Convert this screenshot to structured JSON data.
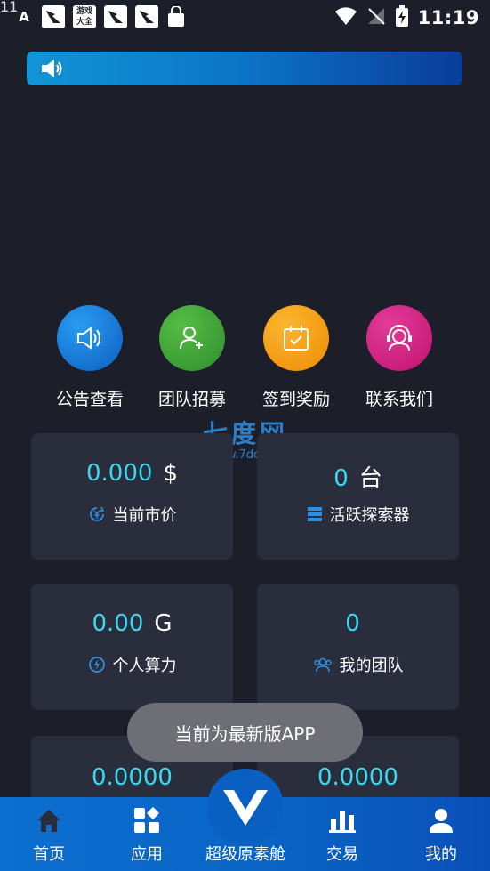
{
  "status_bar": {
    "tiny_text": "11",
    "app_icons": [
      "A",
      "",
      "游戏大全",
      "",
      "",
      ""
    ],
    "time": "11:19",
    "icons": [
      "wifi-icon",
      "no-signal-icon",
      "battery-charging-icon"
    ]
  },
  "notice": {
    "text": ""
  },
  "quick_actions": [
    {
      "label": "公告查看",
      "icon": "speaker-icon",
      "color": "#1c82de"
    },
    {
      "label": "团队招募",
      "icon": "add-user-icon",
      "color": "#3ea63a"
    },
    {
      "label": "签到奖励",
      "icon": "calendar-check-icon",
      "color": "#f5a116"
    },
    {
      "label": "联系我们",
      "icon": "headset-icon",
      "color": "#d41e82"
    }
  ],
  "watermark": {
    "main": "七度网",
    "sub": "www.7do.net"
  },
  "cards": [
    {
      "value": "0.000",
      "unit": "$",
      "label": "当前市价",
      "icon": "yen-circle-icon"
    },
    {
      "value": "0",
      "unit": "台",
      "label": "活跃探索器",
      "icon": "server-icon"
    },
    {
      "value": "0.00",
      "unit": "G",
      "label": "个人算力",
      "icon": "power-circle-icon"
    },
    {
      "value": "0",
      "unit": "",
      "label": "我的团队",
      "icon": "team-icon"
    },
    {
      "value": "0.0000",
      "unit": "",
      "label": "",
      "icon": ""
    },
    {
      "value": "0.0000",
      "unit": "",
      "label": "",
      "icon": ""
    }
  ],
  "toast": {
    "text": "当前为最新版APP"
  },
  "tabbar": {
    "items": [
      {
        "label": "首页",
        "icon": "home-icon"
      },
      {
        "label": "应用",
        "icon": "apps-icon"
      },
      {
        "label": "超级原素舱",
        "icon": "logo-icon"
      },
      {
        "label": "交易",
        "icon": "bar-chart-icon"
      },
      {
        "label": "我的",
        "icon": "user-icon"
      }
    ]
  },
  "colors": {
    "background": "#1c1e2a",
    "card": "#2a2d3c",
    "accent_value": "#3ad8f0",
    "tabbar": "#0a62c4"
  }
}
